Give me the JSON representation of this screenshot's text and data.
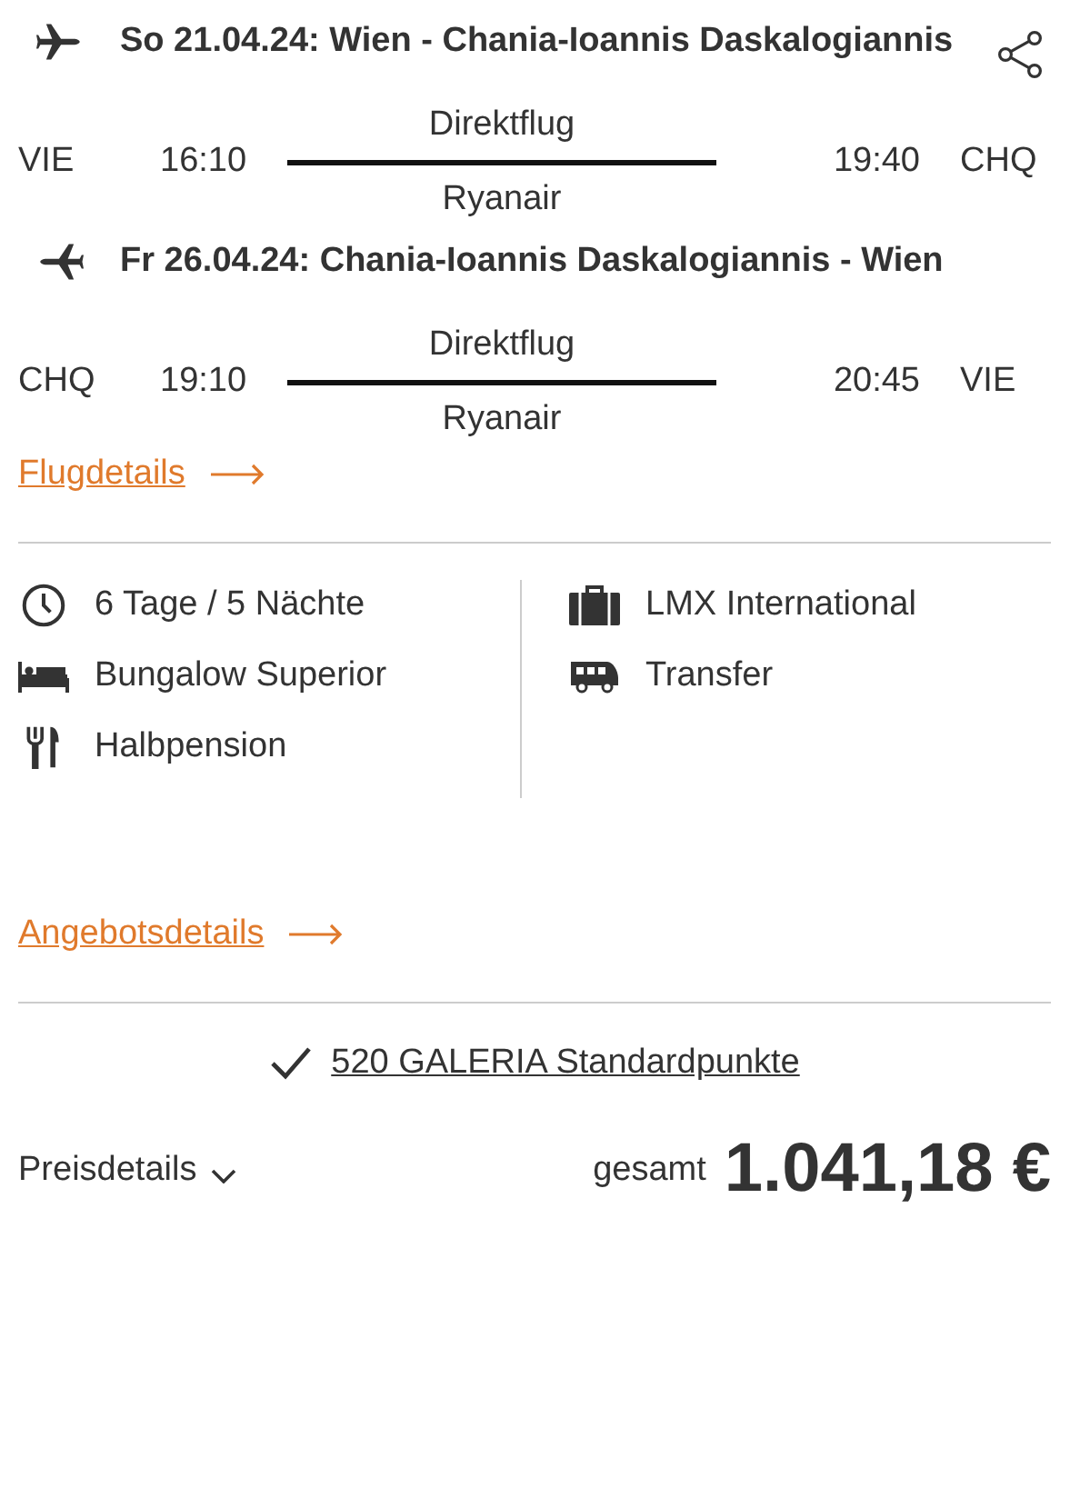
{
  "flights": [
    {
      "kind": "outbound",
      "title": "So 21.04.24: Wien - Chania-Ioannis Daskalogiannis",
      "from": "VIE",
      "departure": "16:10",
      "type": "Direktflug",
      "airline": "Ryanair",
      "arrival": "19:40",
      "to": "CHQ"
    },
    {
      "kind": "return",
      "title": "Fr 26.04.24: Chania-Ioannis Daskalogiannis - Wien",
      "from": "CHQ",
      "departure": "19:10",
      "type": "Direktflug",
      "airline": "Ryanair",
      "arrival": "20:45",
      "to": "VIE"
    }
  ],
  "flight_details_link": "Flugdetails",
  "features_left": [
    {
      "kind": "clock",
      "label": "6 Tage / 5 Nächte"
    },
    {
      "kind": "bed",
      "label": "Bungalow Superior"
    },
    {
      "kind": "cutlery",
      "label": "Halbpension"
    }
  ],
  "features_right": [
    {
      "kind": "suitcase",
      "label": "LMX International"
    },
    {
      "kind": "bus",
      "label": "Transfer"
    }
  ],
  "offer_details_link": "Angebotsdetails",
  "points": "520 GALERIA Standardpunkte",
  "price_details": "Preisdetails",
  "total_label": "gesamt",
  "total_price": "1.041,18 €"
}
